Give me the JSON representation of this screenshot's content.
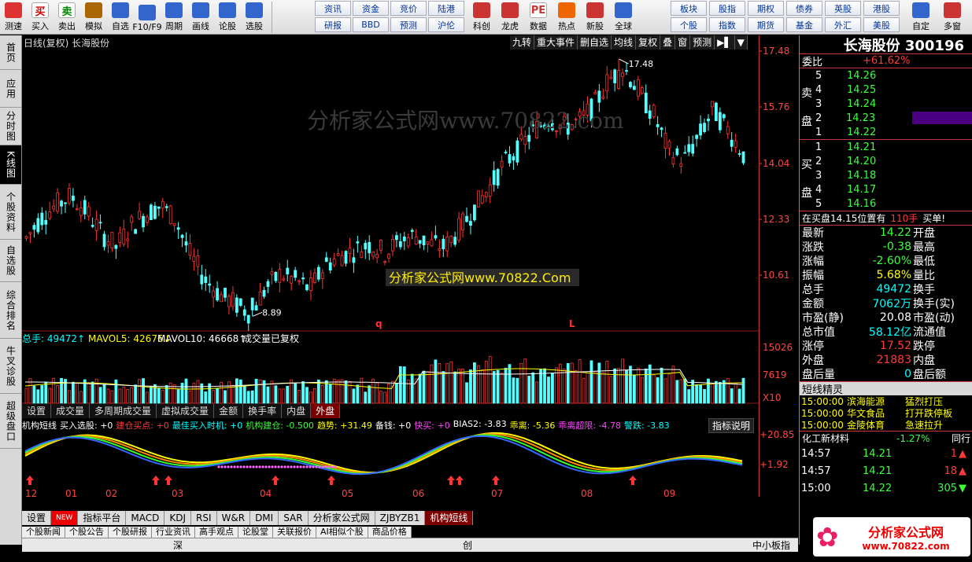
{
  "toolbar": {
    "left_buttons": [
      {
        "label": "测速",
        "icon": "clock-icon"
      },
      {
        "label": "买入",
        "icon": "buy-icon",
        "text": "买"
      },
      {
        "label": "卖出",
        "icon": "sell-icon",
        "text": "卖"
      },
      {
        "label": "模拟",
        "icon": "hammer-icon"
      },
      {
        "label": "自选",
        "icon": "star-icon"
      },
      {
        "label": "F10/F9",
        "icon": "f10-icon"
      },
      {
        "label": "周期",
        "icon": "period-icon"
      },
      {
        "label": "画线",
        "icon": "draw-icon"
      },
      {
        "label": "论股",
        "icon": "forum-icon"
      },
      {
        "label": "选股",
        "icon": "select-icon"
      }
    ],
    "small_buttons_row1": [
      "资讯",
      "资金",
      "竞价",
      "陆港"
    ],
    "small_buttons_row2": [
      "研报",
      "BBD",
      "预测",
      "沪伦"
    ],
    "mid_buttons": [
      {
        "label": "科创",
        "icon": "chart-icon"
      },
      {
        "label": "龙虎",
        "icon": "dragon-icon"
      },
      {
        "label": "数据",
        "icon": "pe-icon",
        "text": "PE"
      },
      {
        "label": "热点",
        "icon": "hot-icon"
      },
      {
        "label": "新股",
        "icon": "newstock-icon"
      },
      {
        "label": "全球",
        "icon": "globe-icon"
      }
    ],
    "right_small_row1": [
      "板块",
      "股指",
      "期权",
      "债券",
      "英股",
      "港股"
    ],
    "right_small_row2": [
      "个股",
      "指数",
      "期货",
      "基金",
      "外汇",
      "美股"
    ],
    "far_buttons": [
      {
        "label": "自定",
        "icon": "custom-icon"
      },
      {
        "label": "多窗",
        "icon": "multiwin-icon"
      }
    ]
  },
  "left_tabs": [
    "首页",
    "应用",
    "分时图",
    "K线图",
    "个股资料",
    "自选股",
    "综合排名",
    "牛叉诊股",
    "超级盘口"
  ],
  "chart": {
    "title": "日线(复权) 长海股份",
    "topbar": [
      "九转",
      "重大事件",
      "删自选",
      "均线",
      "复权",
      "叠",
      "窗",
      "预测"
    ],
    "price_labels": [
      "17.48",
      "15.76",
      "14.04",
      "12.33",
      "10.61"
    ],
    "high_marker": "17.48",
    "low_marker": "8.89",
    "q_marker": "q",
    "l_marker": "L",
    "watermark_big": "分析家公式网www.70822.com",
    "watermark_box": "分析家公式网www.70822.Com",
    "volume_header": {
      "total": "总手: 49472",
      "mavol5": "MAVOL5: 42676",
      "mavol10": "MAVOL10: 46668",
      "note": "成交量已复权"
    },
    "volume_labels": [
      "15026",
      "7619",
      "X10"
    ],
    "volume_tabs": [
      "设置",
      "成交量",
      "多周期成交量",
      "虚拟成交量",
      "金额",
      "换手率",
      "内盘",
      "外盘"
    ],
    "indicator_header": [
      {
        "text": "机构短线",
        "color": "#ffffff"
      },
      {
        "text": "买入选股: +0",
        "color": "#ffffff"
      },
      {
        "text": "建仓买点: +0",
        "color": "#ff3a3a"
      },
      {
        "text": "最佳买入时机: +0",
        "color": "#00ffff"
      },
      {
        "text": "机构建仓: -0.500",
        "color": "#39ff39"
      },
      {
        "text": "趋势: +31.49",
        "color": "#ffff00"
      },
      {
        "text": "备钱: +0",
        "color": "#ffffff"
      },
      {
        "text": "快买: +0",
        "color": "#ff44ff"
      },
      {
        "text": "BIAS2: -3.83",
        "color": "#ffffff"
      },
      {
        "text": "乖离: -5.36",
        "color": "#ffff00"
      },
      {
        "text": "乖离超限: -4.78",
        "color": "#ff44ff"
      },
      {
        "text": "警跌: -3.83",
        "color": "#00ffff"
      }
    ],
    "indicator_help": "指标说明",
    "indicator_labels": [
      "20.85",
      "1.92"
    ],
    "month_labels": [
      "12",
      "01",
      "02",
      "03",
      "04",
      "05",
      "06",
      "07",
      "08",
      "09"
    ],
    "bottom_indicator_tabs": [
      "设置",
      "NEW",
      "指标平台",
      "MACD",
      "KDJ",
      "RSI",
      "W&R",
      "DMI",
      "SAR",
      "分析家公式网",
      "ZJBYZB1",
      "机构短线"
    ]
  },
  "chart_data": {
    "type": "candlestick",
    "title": "日线(复权) 长海股份",
    "ylim": [
      8.89,
      17.48
    ],
    "x_months": [
      "12",
      "01",
      "02",
      "03",
      "04",
      "05",
      "06",
      "07",
      "08",
      "09"
    ],
    "high": 17.48,
    "low": 8.89,
    "close_path": [
      11.5,
      12.2,
      12.6,
      12.9,
      12.4,
      11.7,
      11.2,
      11.9,
      12.3,
      12.6,
      12.1,
      10.9,
      10.1,
      9.6,
      9.3,
      9.0,
      9.8,
      10.3,
      10.1,
      9.8,
      10.6,
      10.9,
      11.1,
      11.3,
      11.0,
      11.4,
      11.6,
      11.3,
      11.2,
      11.8,
      12.5,
      13.2,
      14.0,
      14.5,
      15.1,
      15.5,
      15.2,
      15.4,
      15.9,
      16.8,
      17.2,
      16.4,
      15.6,
      14.4,
      14.1,
      14.9,
      15.8,
      15.1,
      14.3
    ],
    "volume_ylim": [
      0,
      15026
    ]
  },
  "rightpanel": {
    "title": "长海股份 300196",
    "committee_label": "委比",
    "committee_value": "+61.62%",
    "sell_label": "卖盘",
    "buy_label": "买盘",
    "sell": [
      {
        "n": "5",
        "price": "14.26"
      },
      {
        "n": "4",
        "price": "14.25"
      },
      {
        "n": "3",
        "price": "14.24"
      },
      {
        "n": "2",
        "price": "14.23"
      },
      {
        "n": "1",
        "price": "14.22"
      }
    ],
    "buy": [
      {
        "n": "1",
        "price": "14.21"
      },
      {
        "n": "2",
        "price": "14.20"
      },
      {
        "n": "3",
        "price": "14.18"
      },
      {
        "n": "4",
        "price": "14.17"
      },
      {
        "n": "5",
        "price": "14.16"
      }
    ],
    "buy_note": "在买盘14.15位置有",
    "buy_note_qty": "110手",
    "buy_note_tail": "买单!",
    "stats": [
      {
        "l": "最新",
        "v": "14.22",
        "r": "开盘",
        "c": "green"
      },
      {
        "l": "涨跌",
        "v": "-0.38",
        "r": "最高",
        "c": "green"
      },
      {
        "l": "涨幅",
        "v": "-2.60%",
        "r": "最低",
        "c": "green"
      },
      {
        "l": "振幅",
        "v": "5.68%",
        "r": "量比",
        "c": "yellow"
      },
      {
        "l": "总手",
        "v": "49472",
        "r": "换手",
        "c": "cyan"
      },
      {
        "l": "金额",
        "v": "7062万",
        "r": "换手(实)",
        "c": "cyan"
      },
      {
        "l": "市盈(静)",
        "v": "20.08",
        "r": "市盈(动)",
        "c": "white"
      },
      {
        "l": "总市值",
        "v": "58.12亿",
        "r": "流通值",
        "c": "cyan"
      },
      {
        "l": "涨停",
        "v": "17.52",
        "r": "跌停",
        "c": "red"
      },
      {
        "l": "外盘",
        "v": "21883",
        "r": "内盘",
        "c": "red"
      },
      {
        "l": "盘后量",
        "v": "0",
        "r": "盘后额",
        "c": "cyan"
      }
    ],
    "elves_title": "短线精灵",
    "elves": [
      {
        "time": "15:00:00",
        "name": "滨海能源",
        "event": "猛烈打压"
      },
      {
        "time": "15:00:00",
        "name": "华文食品",
        "event": "打开跌停板"
      },
      {
        "time": "15:00:00",
        "name": "金陵体育",
        "event": "急速拉升"
      }
    ],
    "sector": "化工新材料",
    "sector_change": "-1.27%",
    "sector_tail": "同行",
    "ticks": [
      {
        "time": "14:57",
        "price": "14.21",
        "vol": "1",
        "dir": "up"
      },
      {
        "time": "14:57",
        "price": "14.21",
        "vol": "18",
        "dir": "up"
      },
      {
        "time": "15:00",
        "price": "14.22",
        "vol": "305",
        "dir": "down"
      }
    ]
  },
  "bottom": {
    "row1": [
      "个股新闻",
      "个股公告",
      "个股研报",
      "行业资讯",
      "高手观点",
      "论股堂",
      "关联报价",
      "AI相似个股",
      "商品价格"
    ],
    "markets": [
      "深",
      "创",
      "中小板指"
    ],
    "logo_text": "分析家公式网",
    "logo_url": "www.70822.com"
  }
}
